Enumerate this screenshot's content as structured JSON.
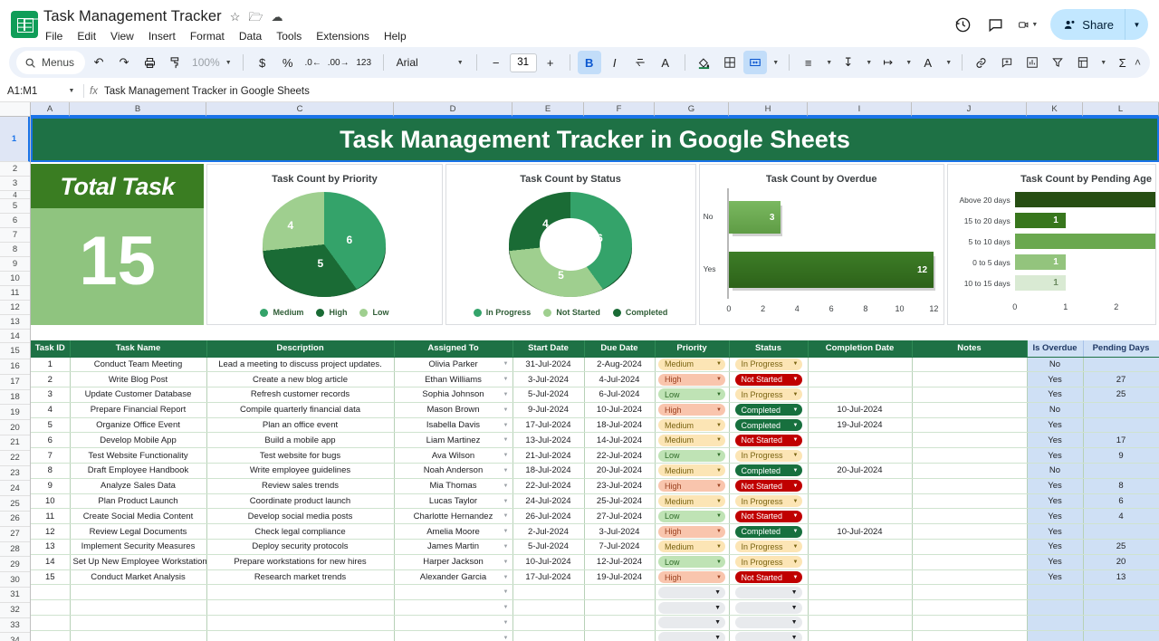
{
  "app": {
    "doc_title": "Task Management Tracker",
    "title_icons": [
      "star-icon",
      "move-to-folder-icon",
      "cloud-saved-icon"
    ],
    "menu": [
      "File",
      "Edit",
      "View",
      "Insert",
      "Format",
      "Data",
      "Tools",
      "Extensions",
      "Help"
    ],
    "top_right": {
      "version_history_icon": "history-icon",
      "comment_icon": "comment-icon",
      "meet_icon": "video-camera-icon",
      "share_label": "Share"
    }
  },
  "toolbar": {
    "menus_label": "Menus",
    "zoom": "100%",
    "font": "Arial",
    "font_size": "31",
    "items": [
      {
        "name": "undo-icon",
        "glyph": "↶"
      },
      {
        "name": "redo-icon",
        "glyph": "↷"
      },
      {
        "name": "print-icon",
        "glyph": "⎙"
      },
      {
        "name": "paint-format-icon",
        "glyph": "⚲"
      },
      {
        "name": "currency-icon",
        "glyph": "$"
      },
      {
        "name": "percent-icon",
        "glyph": "%"
      },
      {
        "name": "decrease-decimal-icon",
        "glyph": ".0"
      },
      {
        "name": "increase-decimal-icon",
        "glyph": ".00"
      },
      {
        "name": "more-formats-icon",
        "glyph": "123"
      },
      {
        "name": "bold-icon",
        "glyph": "B"
      },
      {
        "name": "italic-icon",
        "glyph": "I"
      },
      {
        "name": "strikethrough-icon",
        "glyph": "S̶"
      },
      {
        "name": "text-color-icon",
        "glyph": "A"
      },
      {
        "name": "fill-color-icon",
        "glyph": "◢"
      },
      {
        "name": "borders-icon",
        "glyph": "⊞"
      },
      {
        "name": "merge-cells-icon",
        "glyph": "☰"
      },
      {
        "name": "horizontal-align-icon",
        "glyph": "≡"
      },
      {
        "name": "vertical-align-icon",
        "glyph": "↧"
      },
      {
        "name": "text-wrap-icon",
        "glyph": "↦"
      },
      {
        "name": "text-rotation-icon",
        "glyph": "A"
      },
      {
        "name": "insert-link-icon",
        "glyph": "∞"
      },
      {
        "name": "insert-comment-icon",
        "glyph": "⊞"
      },
      {
        "name": "insert-chart-icon",
        "glyph": "█"
      },
      {
        "name": "create-filter-icon",
        "glyph": "∇"
      },
      {
        "name": "functions-icon",
        "glyph": "▤"
      },
      {
        "name": "sum-icon",
        "glyph": "Σ"
      }
    ],
    "collapse_label": "˄"
  },
  "formula_bar": {
    "name_box": "A1:M1",
    "fx_label": "fx",
    "value": "Task Management Tracker in Google Sheets"
  },
  "grid": {
    "columns": [
      "A",
      "B",
      "C",
      "D",
      "E",
      "F",
      "G",
      "H",
      "I",
      "J",
      "K",
      "L"
    ],
    "rows": [
      1,
      2,
      3,
      4,
      5,
      6,
      7,
      8,
      9,
      10,
      11,
      12,
      13,
      14,
      15,
      16,
      17,
      18,
      19,
      20,
      21,
      22,
      23,
      24,
      25,
      26,
      27,
      28,
      29,
      30,
      31,
      32,
      33,
      34
    ]
  },
  "banner": {
    "title": "Task Management Tracker in Google Sheets"
  },
  "kpi": {
    "label": "Total Task",
    "value": "15"
  },
  "chart_data": [
    {
      "type": "pie",
      "title": "Task Count by Priority",
      "categories": [
        "Medium",
        "High",
        "Low"
      ],
      "values": [
        6,
        5,
        4
      ],
      "colors": [
        "#34a36a",
        "#1a6b35",
        "#9fcf8f"
      ],
      "legend": "bottom"
    },
    {
      "type": "pie",
      "title": "Task Count by Status",
      "categories": [
        "In Progress",
        "Not Started",
        "Completed"
      ],
      "values": [
        6,
        5,
        4
      ],
      "colors": [
        "#34a36a",
        "#9fcf8f",
        "#1a6b35"
      ],
      "legend": "bottom",
      "donut": true
    },
    {
      "type": "bar",
      "title": "Task Count by Overdue",
      "categories": [
        "No",
        "Yes"
      ],
      "values": [
        3,
        12
      ],
      "colors": [
        "#6aa84f",
        "#2e6b1f"
      ],
      "xlabel": "",
      "ylabel": "",
      "xlim": [
        0,
        12
      ],
      "xticks": [
        0,
        2,
        4,
        6,
        8,
        10,
        12
      ],
      "orientation": "horizontal"
    },
    {
      "type": "bar",
      "title": "Task Count by Pending Age",
      "categories": [
        "Above 20 days",
        "15 to 20 days",
        "5 to 10 days",
        "0 to 5 days",
        "10 to 15 days"
      ],
      "values": [
        3,
        1,
        3,
        1,
        1
      ],
      "labels": [
        "",
        "1",
        "",
        "1",
        "1"
      ],
      "colors": [
        "#274e13",
        "#38761d",
        "#6aa84f",
        "#93c47d",
        "#d9ead3"
      ],
      "xlim": [
        0,
        2
      ],
      "xticks": [
        0,
        1,
        2
      ],
      "orientation": "horizontal"
    }
  ],
  "table": {
    "headers": [
      "Task ID",
      "Task Name",
      "Description",
      "Assigned To",
      "Start Date",
      "Due Date",
      "Priority",
      "Status",
      "Completion Date",
      "Notes",
      "Is Overdue",
      "Pending Days"
    ],
    "rows": [
      {
        "id": "1",
        "name": "Conduct Team Meeting",
        "desc": "Lead a meeting to discuss project updates.",
        "assignee": "Olivia Parker",
        "start": "31-Jul-2024",
        "due": "2-Aug-2024",
        "priority": "Medium",
        "status": "In Progress",
        "completion": "",
        "notes": "",
        "overdue": "No",
        "pending": ""
      },
      {
        "id": "2",
        "name": "Write Blog Post",
        "desc": "Create a new blog article",
        "assignee": "Ethan Williams",
        "start": "3-Jul-2024",
        "due": "4-Jul-2024",
        "priority": "High",
        "status": "Not Started",
        "completion": "",
        "notes": "",
        "overdue": "Yes",
        "pending": "27"
      },
      {
        "id": "3",
        "name": "Update Customer Database",
        "desc": "Refresh customer records",
        "assignee": "Sophia Johnson",
        "start": "5-Jul-2024",
        "due": "6-Jul-2024",
        "priority": "Low",
        "status": "In Progress",
        "completion": "",
        "notes": "",
        "overdue": "Yes",
        "pending": "25"
      },
      {
        "id": "4",
        "name": "Prepare Financial Report",
        "desc": "Compile quarterly financial data",
        "assignee": "Mason Brown",
        "start": "9-Jul-2024",
        "due": "10-Jul-2024",
        "priority": "High",
        "status": "Completed",
        "completion": "10-Jul-2024",
        "notes": "",
        "overdue": "No",
        "pending": ""
      },
      {
        "id": "5",
        "name": "Organize Office Event",
        "desc": "Plan an office event",
        "assignee": "Isabella Davis",
        "start": "17-Jul-2024",
        "due": "18-Jul-2024",
        "priority": "Medium",
        "status": "Completed",
        "completion": "19-Jul-2024",
        "notes": "",
        "overdue": "Yes",
        "pending": ""
      },
      {
        "id": "6",
        "name": "Develop Mobile App",
        "desc": "Build a mobile app",
        "assignee": "Liam Martinez",
        "start": "13-Jul-2024",
        "due": "14-Jul-2024",
        "priority": "Medium",
        "status": "Not Started",
        "completion": "",
        "notes": "",
        "overdue": "Yes",
        "pending": "17"
      },
      {
        "id": "7",
        "name": "Test Website Functionality",
        "desc": "Test website for bugs",
        "assignee": "Ava Wilson",
        "start": "21-Jul-2024",
        "due": "22-Jul-2024",
        "priority": "Low",
        "status": "In Progress",
        "completion": "",
        "notes": "",
        "overdue": "Yes",
        "pending": "9"
      },
      {
        "id": "8",
        "name": "Draft Employee Handbook",
        "desc": "Write employee guidelines",
        "assignee": "Noah Anderson",
        "start": "18-Jul-2024",
        "due": "20-Jul-2024",
        "priority": "Medium",
        "status": "Completed",
        "completion": "20-Jul-2024",
        "notes": "",
        "overdue": "No",
        "pending": ""
      },
      {
        "id": "9",
        "name": "Analyze Sales Data",
        "desc": "Review sales trends",
        "assignee": "Mia Thomas",
        "start": "22-Jul-2024",
        "due": "23-Jul-2024",
        "priority": "High",
        "status": "Not Started",
        "completion": "",
        "notes": "",
        "overdue": "Yes",
        "pending": "8"
      },
      {
        "id": "10",
        "name": "Plan Product Launch",
        "desc": "Coordinate product launch",
        "assignee": "Lucas Taylor",
        "start": "24-Jul-2024",
        "due": "25-Jul-2024",
        "priority": "Medium",
        "status": "In Progress",
        "completion": "",
        "notes": "",
        "overdue": "Yes",
        "pending": "6"
      },
      {
        "id": "11",
        "name": "Create Social Media Content",
        "desc": "Develop social media posts",
        "assignee": "Charlotte Hernandez",
        "start": "26-Jul-2024",
        "due": "27-Jul-2024",
        "priority": "Low",
        "status": "Not Started",
        "completion": "",
        "notes": "",
        "overdue": "Yes",
        "pending": "4"
      },
      {
        "id": "12",
        "name": "Review Legal Documents",
        "desc": "Check legal compliance",
        "assignee": "Amelia Moore",
        "start": "2-Jul-2024",
        "due": "3-Jul-2024",
        "priority": "High",
        "status": "Completed",
        "completion": "10-Jul-2024",
        "notes": "",
        "overdue": "Yes",
        "pending": ""
      },
      {
        "id": "13",
        "name": "Implement Security Measures",
        "desc": "Deploy security protocols",
        "assignee": "James Martin",
        "start": "5-Jul-2024",
        "due": "7-Jul-2024",
        "priority": "Medium",
        "status": "In Progress",
        "completion": "",
        "notes": "",
        "overdue": "Yes",
        "pending": "25"
      },
      {
        "id": "14",
        "name": "Set Up New Employee Workstations",
        "desc": "Prepare workstations for new hires",
        "assignee": "Harper Jackson",
        "start": "10-Jul-2024",
        "due": "12-Jul-2024",
        "priority": "Low",
        "status": "In Progress",
        "completion": "",
        "notes": "",
        "overdue": "Yes",
        "pending": "20"
      },
      {
        "id": "15",
        "name": "Conduct Market Analysis",
        "desc": "Research market trends",
        "assignee": "Alexander Garcia",
        "start": "17-Jul-2024",
        "due": "19-Jul-2024",
        "priority": "High",
        "status": "Not Started",
        "completion": "",
        "notes": "",
        "overdue": "Yes",
        "pending": "13"
      }
    ],
    "empty_rows": 4,
    "priority_colors": {
      "Medium": "#fce5b5",
      "High": "#f9c5ad",
      "Low": "#bfe3b5"
    },
    "priority_text": {
      "Medium": "#7a6412",
      "High": "#9c4221",
      "Low": "#2f6b28"
    },
    "status_colors": {
      "In Progress": "#fce5b5",
      "Not Started": "#c00000",
      "Completed": "#17703e"
    },
    "status_text": {
      "In Progress": "#7a6412",
      "Not Started": "#ffffff",
      "Completed": "#ffffff"
    }
  }
}
